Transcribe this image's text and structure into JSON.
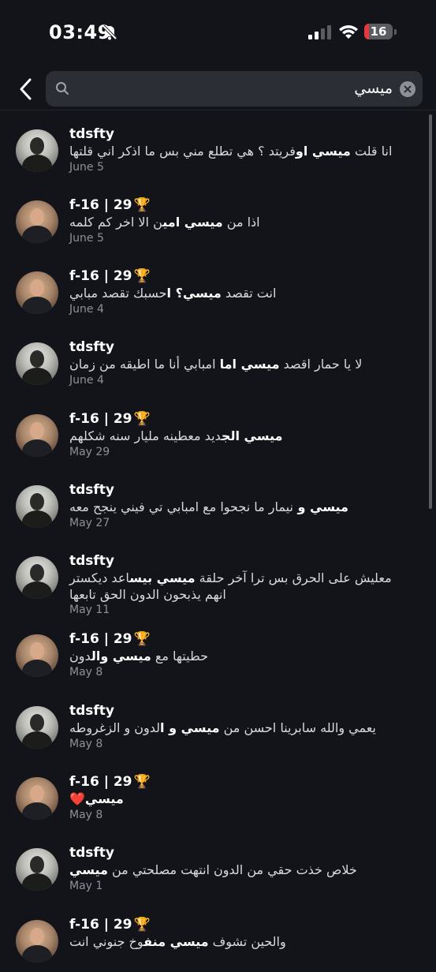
{
  "status": {
    "time": "03:49",
    "battery": "16",
    "battery_level": 0.16,
    "icons": [
      "bell-slash-icon",
      "signal-icon",
      "wifi-icon",
      "battery-icon"
    ]
  },
  "search": {
    "query": "ميسي",
    "back_icon": "chevron-left-icon",
    "search_icon": "search-icon",
    "clear_icon": "clear-icon"
  },
  "results": [
    {
      "name": "tdsfty",
      "avatar": "tds",
      "pre": "انا قلت ",
      "hl": "ميسي او",
      "post": "فريتد ؟ هي تطلع مني بس ما اذكر اني قلتها",
      "date": "June 5"
    },
    {
      "name": "f-16 | 29",
      "trophy": "🏆",
      "avatar": "f16",
      "pre": "اذا من ",
      "hl": "ميسي امي",
      "post": "ن الا اخر كم كلمه",
      "date": "June 5"
    },
    {
      "name": "f-16 | 29",
      "trophy": "🏆",
      "avatar": "f16",
      "pre": "انت تقصد ",
      "hl": "ميسي؟ ا",
      "post": "حسبك تقصد مبابي",
      "date": "June 4"
    },
    {
      "name": "tdsfty",
      "avatar": "tds",
      "pre": "لا يا حمار اقصد ",
      "hl": "ميسي اما",
      "post": " امبابي أنا ما اطيقه من زمان",
      "date": "June 4"
    },
    {
      "name": "f-16 | 29",
      "trophy": "🏆",
      "avatar": "f16",
      "pre": "",
      "hl": "ميسي الج",
      "post": "ديد معطينه مليار سنه شكلهم",
      "date": "May 29"
    },
    {
      "name": "tdsfty",
      "avatar": "tds",
      "pre": "",
      "hl": "ميسي و ",
      "post": "نيمار ما نجحوا مع امبابي تي فيني ينجح معه",
      "date": "May 27"
    },
    {
      "name": "tdsfty",
      "avatar": "tds",
      "pre": "معليش على الحرق بس ترا آخر حلقة ",
      "hl": "ميسي بيس",
      "post": "اعد ديكستر انهم يذبحون الدون الحق تابعها",
      "date": "May 11"
    },
    {
      "name": "f-16 | 29",
      "trophy": "🏆",
      "avatar": "f16",
      "pre": "حطيتها مع ",
      "hl": "ميسي وال",
      "post": "دون",
      "date": "May 8"
    },
    {
      "name": "tdsfty",
      "avatar": "tds",
      "pre": "يعمي والله سابرينا احسن من ",
      "hl": "ميسي و ا",
      "post": "لدون و الزغروطه",
      "date": "May 8"
    },
    {
      "name": "f-16 | 29",
      "trophy": "🏆",
      "avatar": "f16",
      "pre": "",
      "hl": "ميسي",
      "post": "",
      "heart": "❤️",
      "date": "May 8"
    },
    {
      "name": "tdsfty",
      "avatar": "tds",
      "pre": "خلاص خذت حقي من الدون انتهت مصلحتي من ",
      "hl": "ميسي",
      "post": "",
      "date": "May 1"
    },
    {
      "name": "f-16 | 29",
      "trophy": "🏆",
      "avatar": "f16",
      "pre": "والحين تشوف ",
      "hl": "ميسي منف",
      "post": "وخ جنوني انت",
      "date": ""
    }
  ]
}
